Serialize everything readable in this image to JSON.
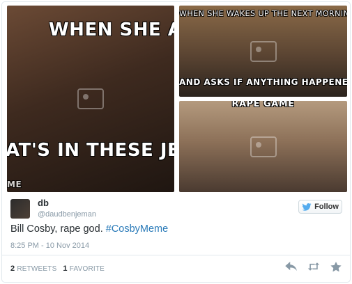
{
  "media": {
    "photo1": {
      "caption_top": "WHEN SHE AS",
      "caption_bottom": "AT'S IN THESE JELL",
      "caption_corner": "ME"
    },
    "photo2": {
      "caption_top": "WHEN SHE WAKES UP THE NEXT MORNING",
      "caption_bottom": "AND ASKS IF ANYTHING HAPPENED"
    },
    "photo3": {
      "caption_top": "RAPE GAME"
    }
  },
  "tweet": {
    "display_name": "db",
    "handle": "@daudbenjeman",
    "text_plain": "Bill Cosby, rape god. ",
    "hashtag": "#CosbyMeme",
    "timestamp": "8:25 PM - 10 Nov 2014"
  },
  "follow": {
    "label": "Follow",
    "icon": "twitter-bird-icon",
    "color": "#55acee"
  },
  "stats": {
    "retweets_count": "2",
    "retweets_label": "RETWEETS",
    "favorites_count": "1",
    "favorites_label": "FAVORITE"
  },
  "actions": {
    "icons": [
      "reply-icon",
      "retweet-icon",
      "favorite-icon"
    ],
    "color": "#8899a6"
  },
  "colors": {
    "text": "#292f33",
    "muted": "#8899a6",
    "link": "#2b7bb9",
    "border": "#e1e8ed"
  }
}
